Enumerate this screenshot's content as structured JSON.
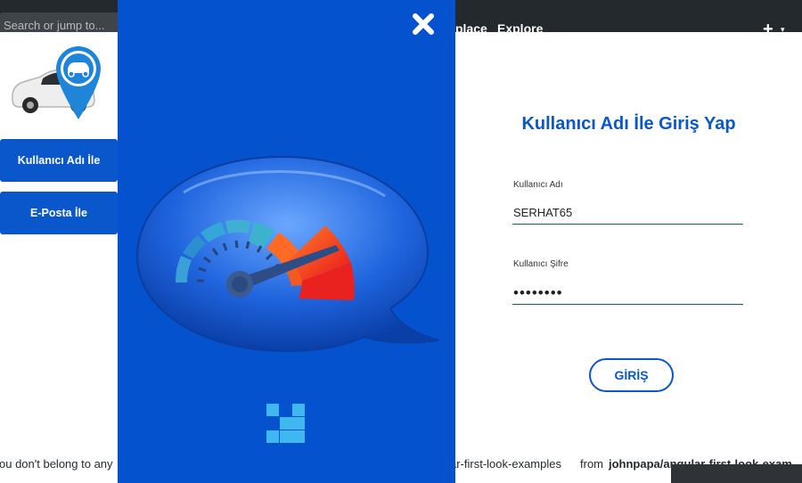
{
  "background_page": {
    "search_placeholder": "Search or jump to...",
    "nav_marketplace_fragment": "place",
    "nav_explore": "Explore",
    "plus_glyph": "+",
    "caret_glyph": "▾",
    "footer_left_fragment": "ou don't belong to any",
    "footer_repo_fragment": "ar-first-look-examples",
    "footer_from": "from",
    "footer_source_fragment": "johnpapa/angular-first-look-exam"
  },
  "sidebar": {
    "items": [
      {
        "label": "Kullanıcı Adı İle"
      },
      {
        "label": "E-Posta İle"
      }
    ]
  },
  "modal": {
    "close_glyph": "✕",
    "title": "Kullanıcı Adı İle Giriş Yap",
    "username": {
      "label": "Kullanıcı Adı",
      "value": "SERHAT65"
    },
    "password": {
      "label": "Kullanıcı Şifre",
      "value": "••••••••"
    },
    "submit_label": "GİRİŞ"
  },
  "colors": {
    "brand_blue": "#0a57cc",
    "panel_blue": "#0552cf",
    "header_dark": "#24292e"
  },
  "icons": {
    "close": "close-icon",
    "logo": "car-location-pin-icon",
    "illustration": "speedometer-bubble-icon",
    "mini_logo": "pixel-logo-icon"
  }
}
